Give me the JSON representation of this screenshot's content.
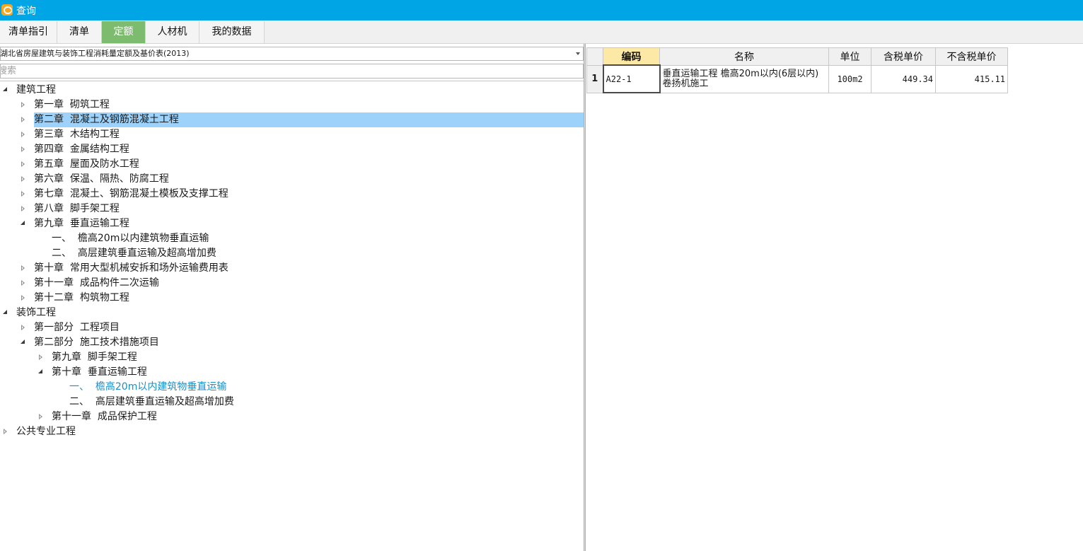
{
  "window": {
    "title": "查询"
  },
  "tabs": [
    {
      "label": "清单指引",
      "active": false
    },
    {
      "label": "清单",
      "active": false
    },
    {
      "label": "定额",
      "active": true
    },
    {
      "label": "人材机",
      "active": false
    },
    {
      "label": "我的数据",
      "active": false
    }
  ],
  "library": {
    "selected": "湖北省房屋建筑与装饰工程消耗量定额及基价表(2013)"
  },
  "search": {
    "placeholder": "搜索"
  },
  "tree": [
    {
      "label": "建筑工程",
      "level": 0,
      "state": "open"
    },
    {
      "label": "第一章  砌筑工程",
      "level": 1,
      "state": "closed"
    },
    {
      "label": "第二章  混凝土及钢筋混凝土工程",
      "level": 1,
      "state": "closed",
      "selected": true
    },
    {
      "label": "第三章  木结构工程",
      "level": 1,
      "state": "closed"
    },
    {
      "label": "第四章  金属结构工程",
      "level": 1,
      "state": "closed"
    },
    {
      "label": "第五章  屋面及防水工程",
      "level": 1,
      "state": "closed"
    },
    {
      "label": "第六章  保温、隔热、防腐工程",
      "level": 1,
      "state": "closed"
    },
    {
      "label": "第七章  混凝土、钢筋混凝土模板及支撑工程",
      "level": 1,
      "state": "closed"
    },
    {
      "label": "第八章  脚手架工程",
      "level": 1,
      "state": "closed"
    },
    {
      "label": "第九章  垂直运输工程",
      "level": 1,
      "state": "open"
    },
    {
      "label": "一、  檐高20m以内建筑物垂直运输",
      "level": 2,
      "state": "leaf"
    },
    {
      "label": "二、  高层建筑垂直运输及超高增加费",
      "level": 2,
      "state": "leaf"
    },
    {
      "label": "第十章  常用大型机械安拆和场外运输费用表",
      "level": 1,
      "state": "closed"
    },
    {
      "label": "第十一章  成品构件二次运输",
      "level": 1,
      "state": "closed"
    },
    {
      "label": "第十二章  构筑物工程",
      "level": 1,
      "state": "closed"
    },
    {
      "label": "装饰工程",
      "level": 0,
      "state": "open"
    },
    {
      "label": "第一部分  工程项目",
      "level": 1,
      "state": "closed"
    },
    {
      "label": "第二部分  施工技术措施项目",
      "level": 1,
      "state": "open"
    },
    {
      "label": "第九章  脚手架工程",
      "level": 2,
      "state": "closed"
    },
    {
      "label": "第十章  垂直运输工程",
      "level": 2,
      "state": "open"
    },
    {
      "label": "一、  檐高20m以内建筑物垂直运输",
      "level": 3,
      "state": "leaf",
      "current": true
    },
    {
      "label": "二、  高层建筑垂直运输及超高增加费",
      "level": 3,
      "state": "leaf"
    },
    {
      "label": "第十一章  成品保护工程",
      "level": 2,
      "state": "closed"
    },
    {
      "label": "公共专业工程",
      "level": 0,
      "state": "closed"
    }
  ],
  "grid": {
    "columns": [
      "编码",
      "名称",
      "单位",
      "含税单价",
      "不含税单价"
    ],
    "rows": [
      {
        "index": "1",
        "code": "A22-1",
        "name": "垂直运输工程 檐高20m以内(6层以内) 卷扬机施工",
        "unit": "100m2",
        "price_tax": "449.34",
        "price_notax": "415.11"
      }
    ]
  },
  "colors": {
    "titlebar": "#00a5e6",
    "active_tab": "#7dbb6e",
    "selection": "#9dd3fb",
    "current_link": "#1b8fc9",
    "sorted_header": "#fde8a6"
  }
}
